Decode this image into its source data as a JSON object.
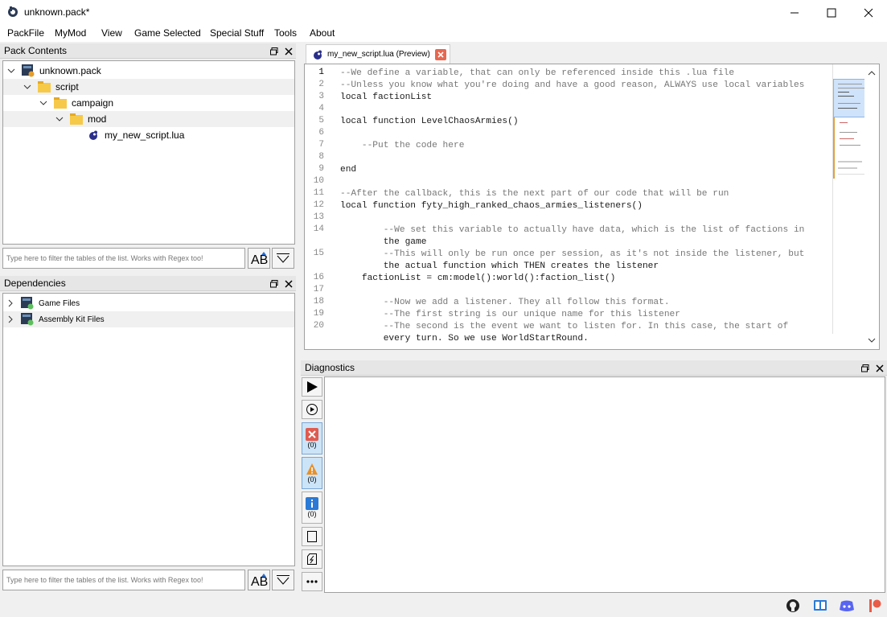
{
  "window": {
    "title": "unknown.pack*"
  },
  "menu": [
    "PackFile",
    "MyMod",
    "View",
    "Game Selected",
    "Special Stuff",
    "Tools",
    "About"
  ],
  "pack_contents": {
    "title": "Pack Contents",
    "tree": [
      {
        "label": "unknown.pack",
        "level": 0,
        "icon": "pack-icon"
      },
      {
        "label": "script",
        "level": 1,
        "icon": "folder-icon"
      },
      {
        "label": "campaign",
        "level": 2,
        "icon": "folder-icon"
      },
      {
        "label": "mod",
        "level": 3,
        "icon": "folder-icon"
      },
      {
        "label": "my_new_script.lua",
        "level": 4,
        "icon": "lua-file-icon"
      }
    ],
    "filter_placeholder": "Type here to filter the tables of the list. Works with Regex too!"
  },
  "dependencies": {
    "title": "Dependencies",
    "tree": [
      {
        "label": "Game Files"
      },
      {
        "label": "Assembly Kit Files"
      }
    ],
    "filter_placeholder": "Type here to filter the tables of the list. Works with Regex too!"
  },
  "editor": {
    "tab_label": "my_new_script.lua (Preview)",
    "lines": [
      {
        "n": "1",
        "text": "--We define a variable, that can only be referenced inside this .lua file"
      },
      {
        "n": "2",
        "text": "--Unless you know what you're doing and have a good reason, ALWAYS use local variables"
      },
      {
        "n": "3",
        "text": "local factionList"
      },
      {
        "n": "4",
        "text": ""
      },
      {
        "n": "5",
        "text": "local function LevelChaosArmies()"
      },
      {
        "n": "6",
        "text": ""
      },
      {
        "n": "7",
        "text": "    --Put the code here"
      },
      {
        "n": "8",
        "text": ""
      },
      {
        "n": "9",
        "text": "end"
      },
      {
        "n": "10",
        "text": ""
      },
      {
        "n": "11",
        "text": "--After the callback, this is the next part of our code that will be run"
      },
      {
        "n": "12",
        "text": "local function fyty_high_ranked_chaos_armies_listeners()"
      },
      {
        "n": "13",
        "text": ""
      },
      {
        "n": "14",
        "text": "        --We set this variable to actually have data, which is the list of factions in"
      },
      {
        "n": "",
        "text": "        the game"
      },
      {
        "n": "15",
        "text": "        --This will only be run once per session, as it's not inside the listener, but"
      },
      {
        "n": "",
        "text": "        the actual function which THEN creates the listener"
      },
      {
        "n": "16",
        "text": "    factionList = cm:model():world():faction_list()"
      },
      {
        "n": "17",
        "text": ""
      },
      {
        "n": "18",
        "text": "        --Now we add a listener. They all follow this format."
      },
      {
        "n": "19",
        "text": "        --The first string is our unique name for this listener"
      },
      {
        "n": "20",
        "text": "        --The second is the event we want to listen for. In this case, the start of"
      },
      {
        "n": "",
        "text": "        every turn. So we use WorldStartRound."
      }
    ]
  },
  "diagnostics": {
    "title": "Diagnostics",
    "errors_count": "(0)",
    "warnings_count": "(0)",
    "info_count": "(0)"
  }
}
